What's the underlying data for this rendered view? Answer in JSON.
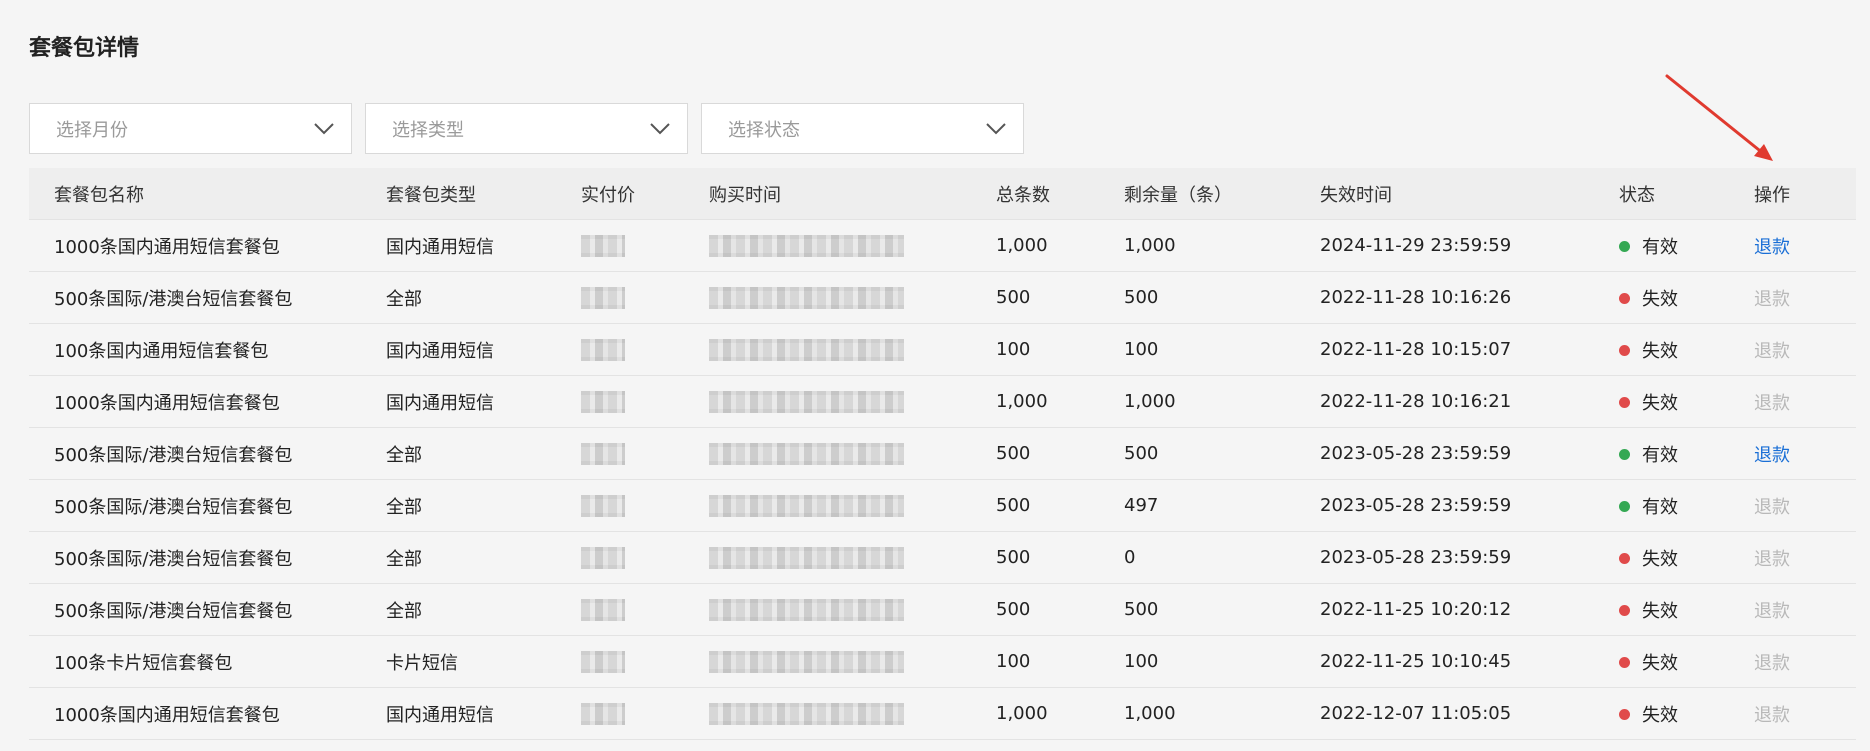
{
  "page": {
    "title": "套餐包详情"
  },
  "filters": {
    "month_placeholder": "选择月份",
    "type_placeholder": "选择类型",
    "status_placeholder": "选择状态"
  },
  "colors": {
    "valid": "#34a853",
    "invalid": "#e04a4a",
    "refund_enabled": "#1a6fd6",
    "refund_disabled": "#b8b8b8",
    "annotation_arrow": "#e03a2f"
  },
  "table": {
    "headers": {
      "name": "套餐包名称",
      "type": "套餐包类型",
      "price": "实付价",
      "purchase_time": "购买时间",
      "total": "总条数",
      "remaining": "剩余量（条）",
      "expire_time": "失效时间",
      "status": "状态",
      "action": "操作"
    },
    "rows": [
      {
        "name": "1000条国内通用短信套餐包",
        "type": "国内通用短信",
        "total": "1,000",
        "remaining": "1,000",
        "expire": "2024-11-29 23:59:59",
        "status": "有效",
        "valid": true,
        "action": "退款",
        "action_enabled": true
      },
      {
        "name": "500条国际/港澳台短信套餐包",
        "type": "全部",
        "total": "500",
        "remaining": "500",
        "expire": "2022-11-28 10:16:26",
        "status": "失效",
        "valid": false,
        "action": "退款",
        "action_enabled": false
      },
      {
        "name": "100条国内通用短信套餐包",
        "type": "国内通用短信",
        "total": "100",
        "remaining": "100",
        "expire": "2022-11-28 10:15:07",
        "status": "失效",
        "valid": false,
        "action": "退款",
        "action_enabled": false
      },
      {
        "name": "1000条国内通用短信套餐包",
        "type": "国内通用短信",
        "total": "1,000",
        "remaining": "1,000",
        "expire": "2022-11-28 10:16:21",
        "status": "失效",
        "valid": false,
        "action": "退款",
        "action_enabled": false
      },
      {
        "name": "500条国际/港澳台短信套餐包",
        "type": "全部",
        "total": "500",
        "remaining": "500",
        "expire": "2023-05-28 23:59:59",
        "status": "有效",
        "valid": true,
        "action": "退款",
        "action_enabled": true
      },
      {
        "name": "500条国际/港澳台短信套餐包",
        "type": "全部",
        "total": "500",
        "remaining": "497",
        "expire": "2023-05-28 23:59:59",
        "status": "有效",
        "valid": true,
        "action": "退款",
        "action_enabled": false
      },
      {
        "name": "500条国际/港澳台短信套餐包",
        "type": "全部",
        "total": "500",
        "remaining": "0",
        "expire": "2023-05-28 23:59:59",
        "status": "失效",
        "valid": false,
        "action": "退款",
        "action_enabled": false
      },
      {
        "name": "500条国际/港澳台短信套餐包",
        "type": "全部",
        "total": "500",
        "remaining": "500",
        "expire": "2022-11-25 10:20:12",
        "status": "失效",
        "valid": false,
        "action": "退款",
        "action_enabled": false
      },
      {
        "name": "100条卡片短信套餐包",
        "type": "卡片短信",
        "total": "100",
        "remaining": "100",
        "expire": "2022-11-25 10:10:45",
        "status": "失效",
        "valid": false,
        "action": "退款",
        "action_enabled": false
      },
      {
        "name": "1000条国内通用短信套餐包",
        "type": "国内通用短信",
        "total": "1,000",
        "remaining": "1,000",
        "expire": "2022-12-07 11:05:05",
        "status": "失效",
        "valid": false,
        "action": "退款",
        "action_enabled": false
      }
    ]
  }
}
